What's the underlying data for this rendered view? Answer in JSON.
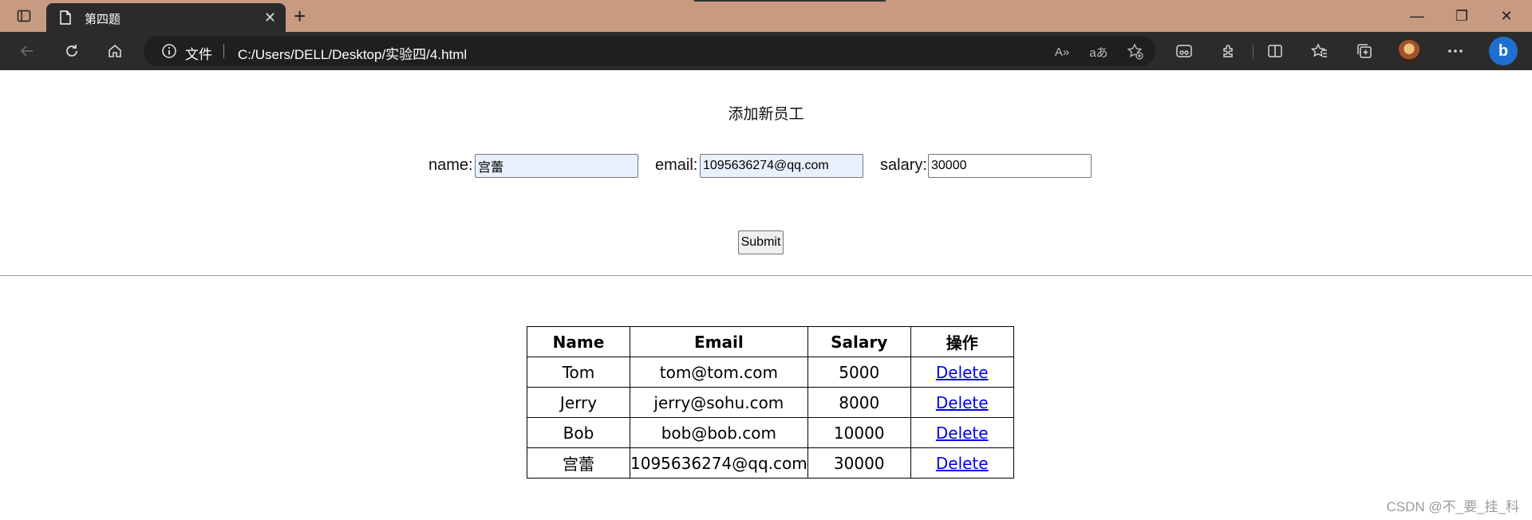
{
  "browser": {
    "tab_title": "第四题",
    "tab_close": "✕",
    "new_tab": "+",
    "address_prefix": "文件",
    "url": "C:/Users/DELL/Desktop/实验四/4.html",
    "read_aloud": "A»",
    "translate": "aあ",
    "window_min": "—",
    "window_restore": "❐",
    "window_close": "✕"
  },
  "page": {
    "heading": "添加新员工",
    "form": {
      "name_label": "name:",
      "name_value": "宫蕾",
      "email_label": "email:",
      "email_value": "1095636274@qq.com",
      "salary_label": "salary:",
      "salary_value": "30000",
      "submit_label": "Submit"
    },
    "table": {
      "headers": [
        "Name",
        "Email",
        "Salary",
        "操作"
      ],
      "rows": [
        {
          "name": "Tom",
          "email": "tom@tom.com",
          "salary": "5000",
          "action": "Delete"
        },
        {
          "name": "Jerry",
          "email": "jerry@sohu.com",
          "salary": "8000",
          "action": "Delete"
        },
        {
          "name": "Bob",
          "email": "bob@bob.com",
          "salary": "10000",
          "action": "Delete"
        },
        {
          "name": "宫蕾",
          "email": "1095636274@qq.com",
          "salary": "30000",
          "action": "Delete"
        }
      ]
    }
  },
  "watermark": "CSDN @不_要_挂_科",
  "colors": {
    "titlebar": "#c79a81",
    "toolbar": "#2b2b2b",
    "link": "#0000ee",
    "autofill": "#e8f0fe"
  }
}
